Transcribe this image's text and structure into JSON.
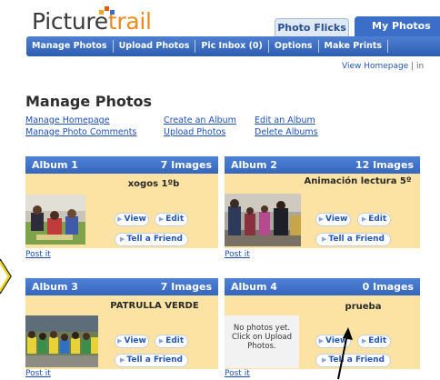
{
  "logo": {
    "part1": "Picture",
    "part2": "trail",
    "colors": [
      "#f5a623",
      "#e85c0d",
      "#3b6ec6",
      "#3a3a3a"
    ]
  },
  "tabs": {
    "photo_flicks": "Photo Flicks",
    "my_photos": "My Photos"
  },
  "nav": {
    "manage_photos": "Manage Photos",
    "upload_photos": "Upload Photos",
    "pic_inbox": "Pic Inbox (0)",
    "options": "Options",
    "make_prints": "Make Prints"
  },
  "view_homepage": "View Homepage",
  "view_homepage_sep": "| in",
  "page_title": "Manage Photos",
  "links": {
    "manage_homepage": "Manage Homepage",
    "manage_photo_comments": "Manage Photo Comments",
    "create_album": "Create an Album",
    "upload_photos": "Upload Photos",
    "edit_album": "Edit an Album",
    "delete_albums": "Delete Albums"
  },
  "buttons": {
    "view": "View",
    "edit": "Edit",
    "tell_friend": "Tell a Friend",
    "post_it": "Post it"
  },
  "albums": [
    {
      "name": "Album 1",
      "count": "7 Images",
      "title": "xogos 1ºb"
    },
    {
      "name": "Album 2",
      "count": "12 Images",
      "title": "Animación lectura 5º"
    },
    {
      "name": "Album 3",
      "count": "7 Images",
      "title": "PATRULLA VERDE"
    },
    {
      "name": "Album 4",
      "count": "0 Images",
      "title": "prueba",
      "no_photos": "No photos yet. Click on Upload Photos."
    }
  ],
  "colors": {
    "nav_blue": "#3b6ec6",
    "card_bg": "#fde3a3",
    "link_blue": "#1d4fbd",
    "accent_orange": "#f08a1c"
  }
}
